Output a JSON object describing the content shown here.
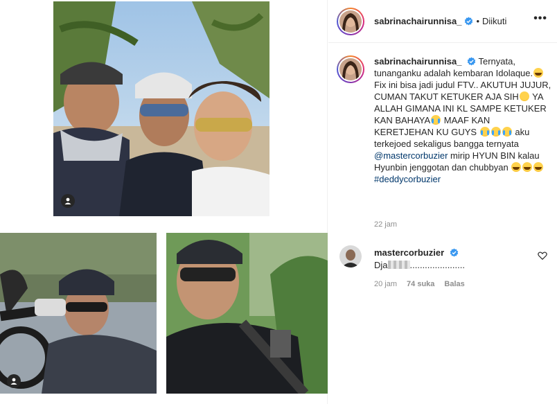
{
  "post": {
    "username": "sabrinachairunnisa_",
    "dot": "•",
    "follow_status": "Diikuti",
    "more": "•••",
    "caption_username": "sabrinachairunnisa_",
    "caption_line1": "Ternyata, tunanganku adalah kembaran Idolaque.",
    "caption_line2": "Fix ini bisa jadi judul FTV.. AKUTUH JUJUR, CUMAN TAKUT KETUKER AJA SIH",
    "caption_line3": "YA ALLAH GIMANA INI KL SAMPE KETUKER KAN BAHAYA",
    "caption_line4": "MAAF KAN KERETJEHAN KU GUYS",
    "caption_line5": "aku terkejoed sekaligus bangga ternyata",
    "mention": "@mastercorbuzier",
    "caption_line6": "mirip HYUN BIN kalau Hyunbin jenggotan dan chubbyan",
    "hashtag": "#deddycorbuzier",
    "time": "22 jam"
  },
  "comment": {
    "username": "mastercorbuzier",
    "text_prefix": "Dja",
    "text_suffix": "......................",
    "time": "20 jam",
    "likes": "74 suka",
    "reply": "Balas"
  },
  "icons": {
    "verified": "verified-badge-icon",
    "heart": "heart-icon",
    "tag": "user-tag-icon"
  },
  "colors": {
    "verified": "#3897f0",
    "link": "#00376b",
    "meta": "#8e8e8e"
  }
}
